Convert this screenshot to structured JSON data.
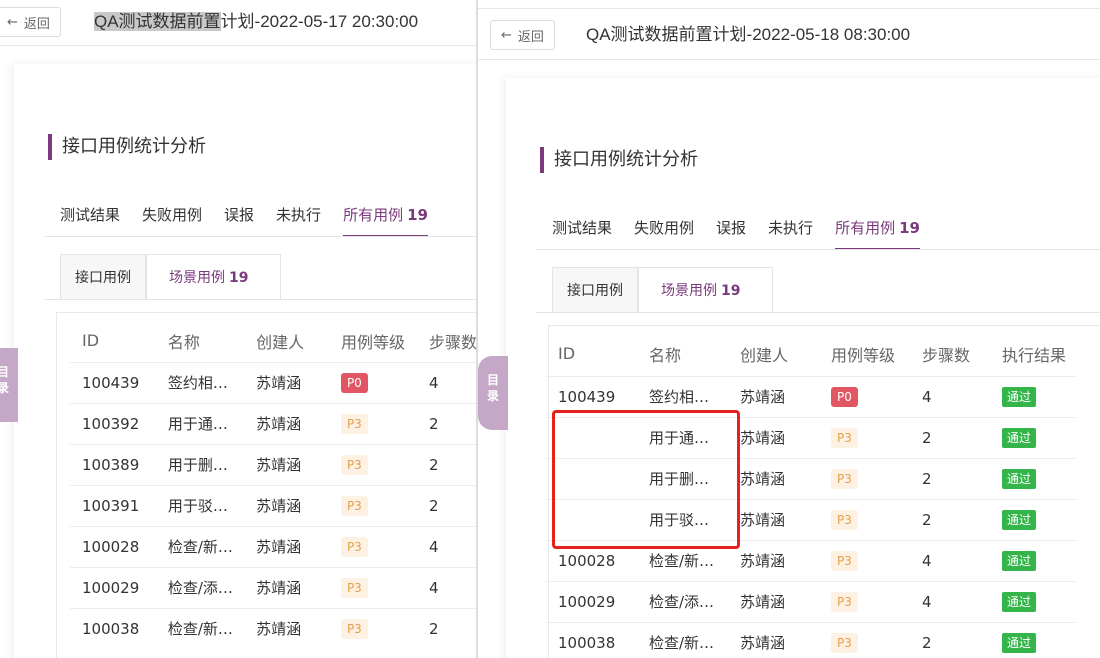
{
  "back_label": "返回",
  "left": {
    "title_hl": "QA测试数据前置",
    "title_rest": "计划-2022-05-17 20:30:00"
  },
  "right": {
    "title": "QA测试数据前置计划-2022-05-18 08:30:00"
  },
  "section_title": "接口用例统计分析",
  "tabs": {
    "results": "测试结果",
    "failed": "失败用例",
    "false_report": "误报",
    "not_run": "未执行",
    "all": "所有用例",
    "all_count": "19"
  },
  "subtabs": {
    "api": "接口用例",
    "scene": "场景用例",
    "scene_count": "19"
  },
  "columns": {
    "id": "ID",
    "name": "名称",
    "creator": "创建人",
    "level": "用例等级",
    "steps": "步骤数",
    "result": "执行结果"
  },
  "side_tab": [
    "目",
    "录"
  ],
  "left_rows": [
    {
      "id": "100439",
      "name": "签约相…",
      "creator": "苏靖涵",
      "level": "P0",
      "steps": "4"
    },
    {
      "id": "100392",
      "name": "用于通…",
      "creator": "苏靖涵",
      "level": "P3",
      "steps": "2"
    },
    {
      "id": "100389",
      "name": "用于删…",
      "creator": "苏靖涵",
      "level": "P3",
      "steps": "2"
    },
    {
      "id": "100391",
      "name": "用于驳…",
      "creator": "苏靖涵",
      "level": "P3",
      "steps": "2"
    },
    {
      "id": "100028",
      "name": "检查/新…",
      "creator": "苏靖涵",
      "level": "P3",
      "steps": "4"
    },
    {
      "id": "100029",
      "name": "检查/添…",
      "creator": "苏靖涵",
      "level": "P3",
      "steps": "4"
    },
    {
      "id": "100038",
      "name": "检查/新…",
      "creator": "苏靖涵",
      "level": "P3",
      "steps": "2"
    }
  ],
  "right_rows": [
    {
      "id": "100439",
      "name": "签约相…",
      "creator": "苏靖涵",
      "level": "P0",
      "steps": "4",
      "result": "通过"
    },
    {
      "id": "",
      "name": "用于通…",
      "creator": "苏靖涵",
      "level": "P3",
      "steps": "2",
      "result": "通过"
    },
    {
      "id": "",
      "name": "用于删…",
      "creator": "苏靖涵",
      "level": "P3",
      "steps": "2",
      "result": "通过"
    },
    {
      "id": "",
      "name": "用于驳…",
      "creator": "苏靖涵",
      "level": "P3",
      "steps": "2",
      "result": "通过"
    },
    {
      "id": "100028",
      "name": "检查/新…",
      "creator": "苏靖涵",
      "level": "P3",
      "steps": "4",
      "result": "通过"
    },
    {
      "id": "100029",
      "name": "检查/添…",
      "creator": "苏靖涵",
      "level": "P3",
      "steps": "4",
      "result": "通过"
    },
    {
      "id": "100038",
      "name": "检查/新…",
      "creator": "苏靖涵",
      "level": "P3",
      "steps": "2",
      "result": "通过"
    }
  ],
  "colors": {
    "accent": "#7b3a7e",
    "p0": "#e25563",
    "p3_bg": "#fdf1e3",
    "pass": "#34b54a",
    "highlight_box": "#e5221c"
  }
}
